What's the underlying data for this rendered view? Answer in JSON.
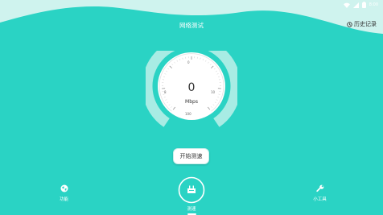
{
  "app": {
    "title": "网络测试"
  },
  "header": {
    "history_label": "历史记录",
    "history_icon": "clock-icon"
  },
  "status_bar": {
    "time": "8:00",
    "icons": [
      "wifi-icon",
      "signal-icon",
      "battery-icon"
    ]
  },
  "gauge": {
    "value": "0",
    "unit": "Mbps",
    "tick_labels": [
      "0",
      "8",
      "10",
      "100"
    ],
    "level": 0
  },
  "actions": {
    "start_label": "开始测速"
  },
  "bottom_nav": {
    "items": [
      {
        "label": "功能",
        "icon": "globe-icon",
        "active": false
      },
      {
        "label": "测速",
        "icon": "speedometer-icon",
        "active": true
      },
      {
        "label": "小工具",
        "icon": "wrench-icon",
        "active": false
      }
    ]
  },
  "colors": {
    "primary": "#2ad3c4",
    "ring": "#a8ece4",
    "text": "#333333"
  }
}
